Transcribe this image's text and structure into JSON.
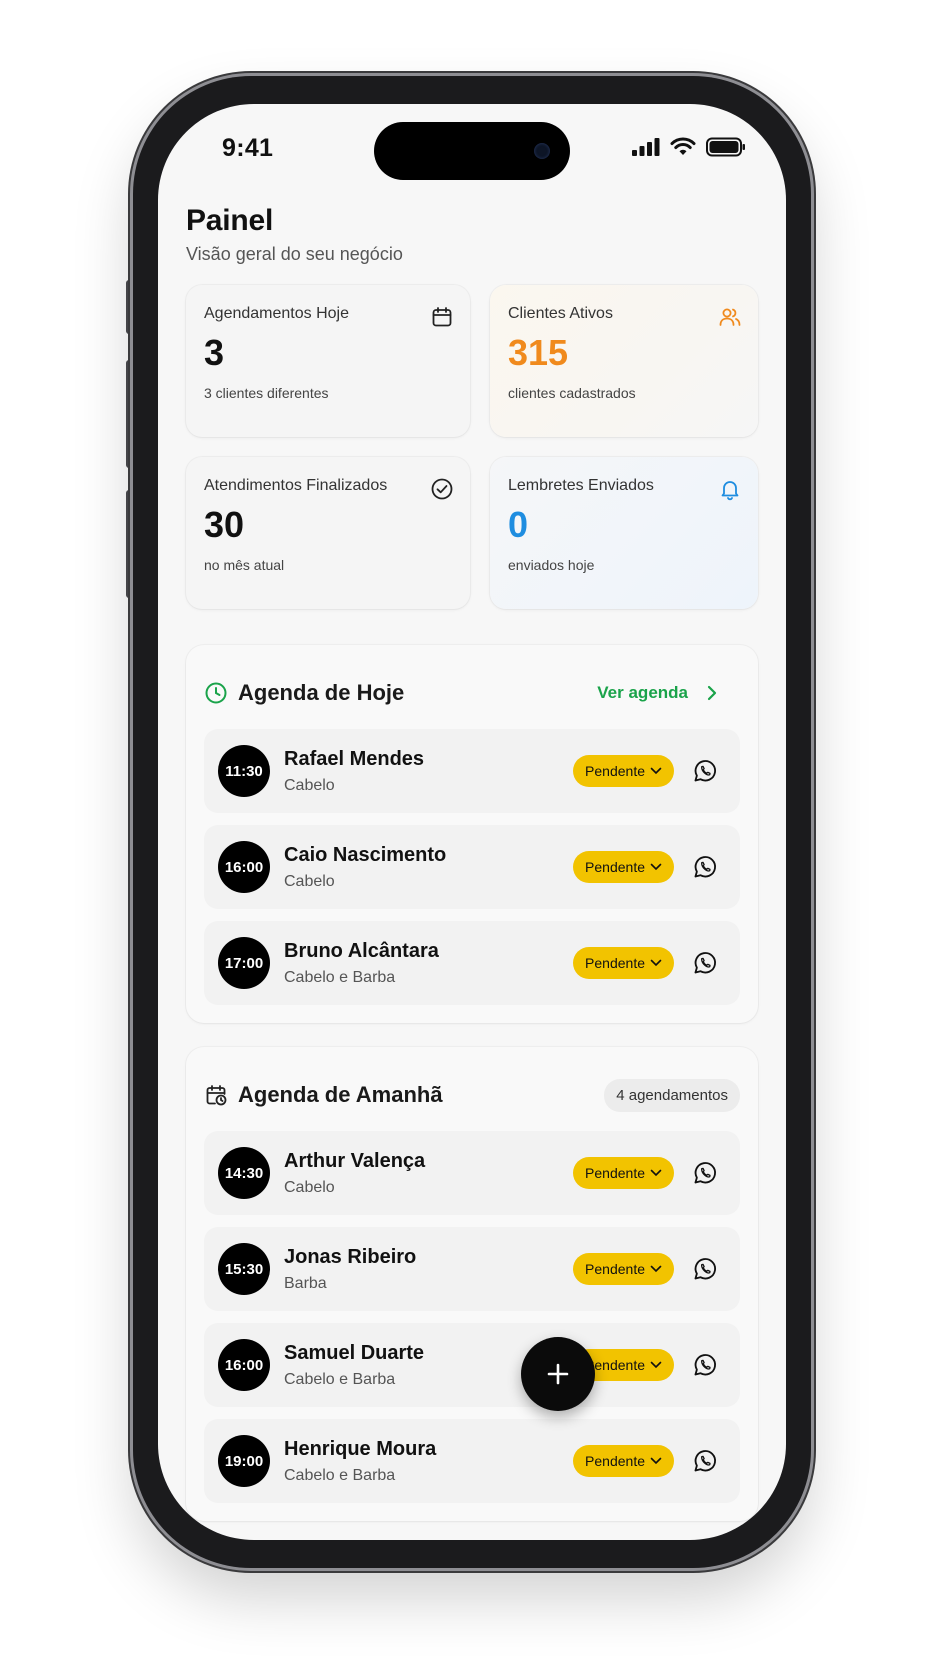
{
  "status_bar": {
    "time": "9:41"
  },
  "header": {
    "title": "Painel",
    "subtitle": "Visão geral do seu negócio"
  },
  "stats": [
    {
      "label": "Agendamentos Hoje",
      "value": "3",
      "sub": "3 clientes diferentes",
      "icon": "calendar-icon",
      "color": "#111111"
    },
    {
      "label": "Clientes Ativos",
      "value": "315",
      "sub": "clientes cadastrados",
      "icon": "users-icon",
      "color": "#f08a1d"
    },
    {
      "label": "Atendimentos Finalizados",
      "value": "30",
      "sub": "no mês atual",
      "icon": "check-circle-icon",
      "color": "#111111"
    },
    {
      "label": "Lembretes Enviados",
      "value": "0",
      "sub": "enviados hoje",
      "icon": "bell-icon",
      "color": "#1e8de0"
    }
  ],
  "today": {
    "title": "Agenda de Hoje",
    "link_label": "Ver agenda",
    "appointments": [
      {
        "time": "11:30",
        "name": "Rafael Mendes",
        "service": "Cabelo",
        "status": "Pendente"
      },
      {
        "time": "16:00",
        "name": "Caio Nascimento",
        "service": "Cabelo",
        "status": "Pendente"
      },
      {
        "time": "17:00",
        "name": "Bruno Alcântara",
        "service": "Cabelo e Barba",
        "status": "Pendente"
      }
    ]
  },
  "tomorrow": {
    "title": "Agenda de Amanhã",
    "count_label": "4 agendamentos",
    "appointments": [
      {
        "time": "14:30",
        "name": "Arthur Valença",
        "service": "Cabelo",
        "status": "Pendente"
      },
      {
        "time": "15:30",
        "name": "Jonas Ribeiro",
        "service": "Barba",
        "status": "Pendente"
      },
      {
        "time": "16:00",
        "name": "Samuel Duarte",
        "service": "Cabelo e Barba",
        "status": "Pendente"
      },
      {
        "time": "19:00",
        "name": "Henrique Moura",
        "service": "Cabelo e Barba",
        "status": "Pendente"
      }
    ]
  },
  "colors": {
    "accent_green": "#1aa34a",
    "pending_yellow": "#f2c300"
  },
  "fab": {
    "icon": "plus-icon"
  }
}
